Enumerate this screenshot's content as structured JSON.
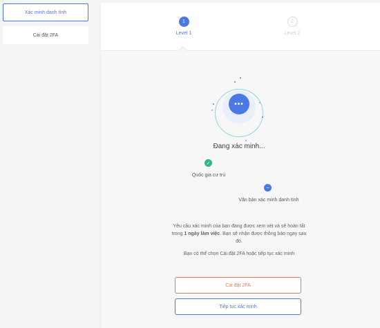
{
  "sidebar": {
    "items": [
      {
        "label": "Xác minh danh tính",
        "active": true
      },
      {
        "label": "Cài đặt 2FA",
        "active": false
      }
    ]
  },
  "steps": [
    {
      "number": "1",
      "label": "Level 1",
      "state": "active"
    },
    {
      "number": "2",
      "label": "Level 2",
      "state": "inactive"
    }
  ],
  "status": {
    "icon": "more-dots-icon",
    "icon_text": "•••",
    "title": "Đang xác minh...",
    "items": [
      {
        "icon": "check-icon",
        "icon_text": "✓",
        "label": "Quốc gia cư trú",
        "state": "done"
      },
      {
        "icon": "minus-icon",
        "icon_text": "−",
        "label": "Văn bản xác minh danh tính",
        "state": "pending"
      }
    ],
    "message_prefix": "Yêu cầu xác minh của bạn đang được xem xét và sẽ hoàn tất trong ",
    "message_bold": "1 ngày làm việc",
    "message_suffix": ". Bạn sẽ nhận được thông báo ngay sau đó.",
    "hint": "Bạn có thể chọn Cài đặt 2FA hoặc tiếp tục xác minh"
  },
  "buttons": {
    "setup_2fa": "Cài đặt 2FA",
    "continue": "Tiếp tục xác minh"
  },
  "colors": {
    "accent": "#4a78e6",
    "success": "#2fb58d",
    "warning": "#e07b52",
    "ring": "#8ed7d9"
  }
}
